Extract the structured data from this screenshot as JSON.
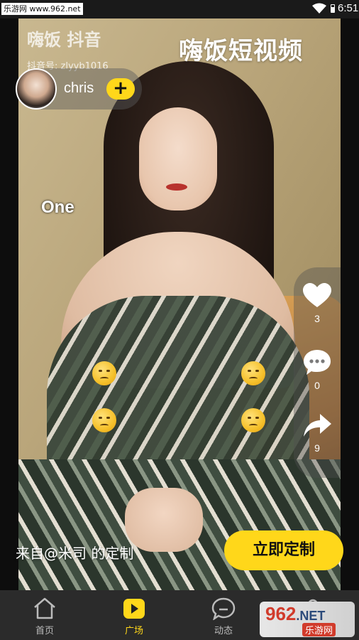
{
  "status_bar": {
    "watermark_badge": "乐游网 www.962.net",
    "time": "6:51"
  },
  "video": {
    "app_logo": "嗨饭 抖音",
    "douyin_id": "抖音号: zlyyb1016",
    "brand_title": "嗨饭短视频",
    "overlay_tag": "One",
    "caption": "来自@米司 的定制"
  },
  "user": {
    "name": "chris",
    "follow_label": "+"
  },
  "actions": {
    "like_count": "3",
    "comment_count": "0",
    "share_count": "9"
  },
  "cta": {
    "label": "立即定制"
  },
  "bottom_nav": {
    "items": [
      {
        "label": "首页",
        "icon": "home-icon"
      },
      {
        "label": "广场",
        "icon": "play-icon"
      },
      {
        "label": "动态",
        "icon": "chat-icon"
      },
      {
        "label": "",
        "icon": "profile-icon"
      }
    ],
    "active_index": 1
  },
  "watermark": {
    "main": "962",
    "suffix": ".NET",
    "sub": "乐游网"
  },
  "colors": {
    "accent": "#ffd71a",
    "nav_bg": "#2b2b2b"
  }
}
